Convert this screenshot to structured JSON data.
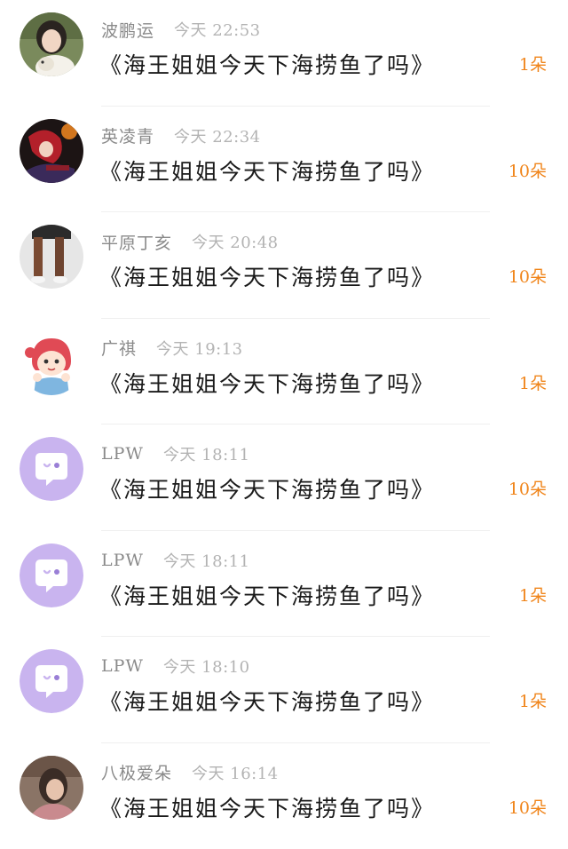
{
  "colors": {
    "count_accent": "#f0851b",
    "name_gray": "#8a8a8a",
    "time_gray": "#b3b3b3",
    "default_avatar_bg": "#c9b4ef"
  },
  "items": [
    {
      "avatar": "photo-girl-with-dog",
      "name": "波鹏运",
      "time": "今天 22:53",
      "message": "《海王姐姐今天下海捞鱼了吗》",
      "count": "1朵"
    },
    {
      "avatar": "anime-red-hair",
      "name": "英凌青",
      "time": "今天 22:34",
      "message": "《海王姐姐今天下海捞鱼了吗》",
      "count": "10朵"
    },
    {
      "avatar": "photo-legs",
      "name": "平原丁亥",
      "time": "今天 20:48",
      "message": "《海王姐姐今天下海捞鱼了吗》",
      "count": "10朵"
    },
    {
      "avatar": "cartoon-girl",
      "name": "广祺",
      "time": "今天 19:13",
      "message": "《海王姐姐今天下海捞鱼了吗》",
      "count": "1朵"
    },
    {
      "avatar": "default-chat-bubble",
      "name": "LPW",
      "time": "今天 18:11",
      "message": "《海王姐姐今天下海捞鱼了吗》",
      "count": "10朵"
    },
    {
      "avatar": "default-chat-bubble",
      "name": "LPW",
      "time": "今天 18:11",
      "message": "《海王姐姐今天下海捞鱼了吗》",
      "count": "1朵"
    },
    {
      "avatar": "default-chat-bubble",
      "name": "LPW",
      "time": "今天 18:10",
      "message": "《海王姐姐今天下海捞鱼了吗》",
      "count": "1朵"
    },
    {
      "avatar": "photo-portrait",
      "name": "八极爱朵",
      "time": "今天 16:14",
      "message": "《海王姐姐今天下海捞鱼了吗》",
      "count": "10朵"
    }
  ]
}
